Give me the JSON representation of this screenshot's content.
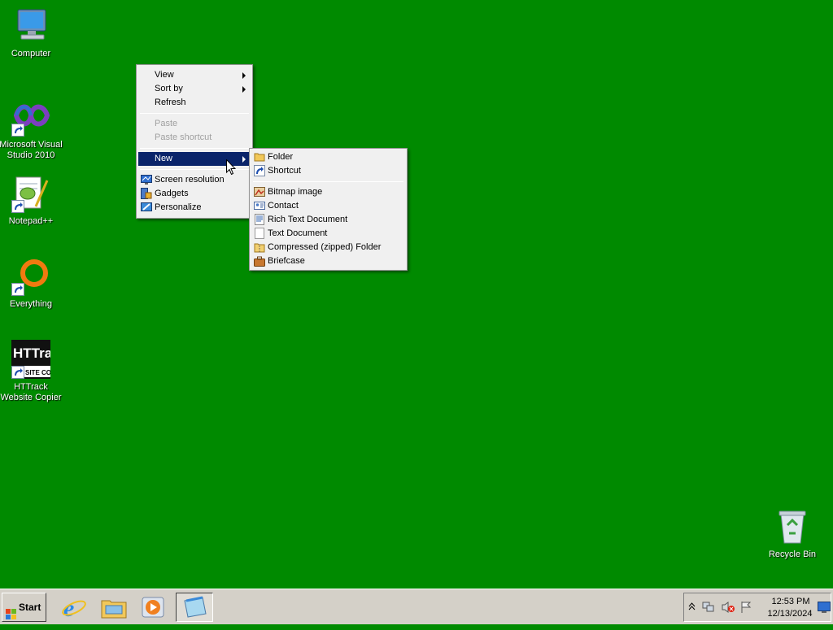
{
  "desktop": {
    "icons": [
      {
        "label": "Computer"
      },
      {
        "label": "Microsoft Visual Studio 2010"
      },
      {
        "label": "Notepad++"
      },
      {
        "label": "Everything"
      },
      {
        "label": "HTTrack Website Copier"
      },
      {
        "label": "Recycle Bin"
      }
    ]
  },
  "context_menu": {
    "items": [
      {
        "label": "View"
      },
      {
        "label": "Sort by"
      },
      {
        "label": "Refresh"
      },
      {
        "label": "Paste"
      },
      {
        "label": "Paste shortcut"
      },
      {
        "label": "New"
      },
      {
        "label": "Screen resolution"
      },
      {
        "label": "Gadgets"
      },
      {
        "label": "Personalize"
      }
    ]
  },
  "new_submenu": {
    "items": [
      {
        "label": "Folder"
      },
      {
        "label": "Shortcut"
      },
      {
        "label": "Bitmap image"
      },
      {
        "label": "Contact"
      },
      {
        "label": "Rich Text Document"
      },
      {
        "label": "Text Document"
      },
      {
        "label": "Compressed (zipped) Folder"
      },
      {
        "label": "Briefcase"
      }
    ]
  },
  "taskbar": {
    "start_label": "Start",
    "clock_time": "12:53 PM",
    "clock_date": "12/13/2024"
  },
  "colors": {
    "desktop_bg": "#008a00",
    "menu_highlight": "#0a246a",
    "taskbar_bg": "#d4d0c8"
  }
}
